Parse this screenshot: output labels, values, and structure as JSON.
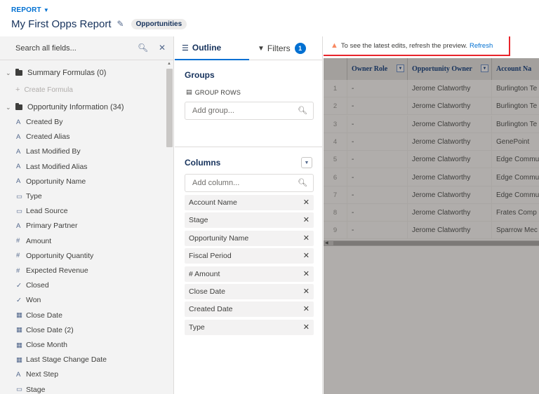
{
  "header": {
    "report_label": "REPORT",
    "title": "My First Opps Report",
    "type_pill": "Opportunities"
  },
  "field_panel": {
    "search_placeholder": "Search all fields...",
    "summary_folder": "Summary Formulas (0)",
    "create_formula": "Create Formula",
    "info_folder": "Opportunity Information (34)",
    "fields": [
      {
        "icon": "A",
        "label": "Created By"
      },
      {
        "icon": "A",
        "label": "Created Alias"
      },
      {
        "icon": "A",
        "label": "Last Modified By"
      },
      {
        "icon": "A",
        "label": "Last Modified Alias"
      },
      {
        "icon": "A",
        "label": "Opportunity Name"
      },
      {
        "icon": "▭",
        "label": "Type"
      },
      {
        "icon": "▭",
        "label": "Lead Source"
      },
      {
        "icon": "A",
        "label": "Primary Partner"
      },
      {
        "icon": "#",
        "label": "Amount"
      },
      {
        "icon": "#",
        "label": "Opportunity Quantity"
      },
      {
        "icon": "#",
        "label": "Expected Revenue"
      },
      {
        "icon": "✓",
        "label": "Closed"
      },
      {
        "icon": "✓",
        "label": "Won"
      },
      {
        "icon": "▦",
        "label": "Close Date"
      },
      {
        "icon": "▦",
        "label": "Close Date (2)"
      },
      {
        "icon": "▦",
        "label": "Close Month"
      },
      {
        "icon": "▦",
        "label": "Last Stage Change Date"
      },
      {
        "icon": "A",
        "label": "Next Step"
      },
      {
        "icon": "▭",
        "label": "Stage"
      }
    ]
  },
  "outline": {
    "tab_outline": "Outline",
    "tab_filters": "Filters",
    "filters_count": "1",
    "groups_title": "Groups",
    "group_rows_label": "GROUP ROWS",
    "add_group_placeholder": "Add group...",
    "columns_title": "Columns",
    "add_column_placeholder": "Add column...",
    "columns": [
      {
        "label": "Account Name"
      },
      {
        "label": "Stage"
      },
      {
        "label": "Opportunity Name"
      },
      {
        "label": "Fiscal Period"
      },
      {
        "label": "# Amount"
      },
      {
        "label": "Close Date"
      },
      {
        "label": "Created Date"
      },
      {
        "label": "Type"
      }
    ]
  },
  "preview": {
    "warning_text": "To see the latest edits, refresh the preview.",
    "refresh_link": "Refresh",
    "headers": [
      "Owner Role",
      "Opportunity Owner",
      "Account Na"
    ],
    "rows": [
      {
        "n": "1",
        "role": "-",
        "owner": "Jerome Clatworthy",
        "account": "Burlington Te"
      },
      {
        "n": "2",
        "role": "-",
        "owner": "Jerome Clatworthy",
        "account": "Burlington Te"
      },
      {
        "n": "3",
        "role": "-",
        "owner": "Jerome Clatworthy",
        "account": "Burlington Te"
      },
      {
        "n": "4",
        "role": "-",
        "owner": "Jerome Clatworthy",
        "account": "GenePoint"
      },
      {
        "n": "5",
        "role": "-",
        "owner": "Jerome Clatworthy",
        "account": "Edge Commu"
      },
      {
        "n": "6",
        "role": "-",
        "owner": "Jerome Clatworthy",
        "account": "Edge Commu"
      },
      {
        "n": "7",
        "role": "-",
        "owner": "Jerome Clatworthy",
        "account": "Edge Commu"
      },
      {
        "n": "8",
        "role": "-",
        "owner": "Jerome Clatworthy",
        "account": "Frates Comp"
      },
      {
        "n": "9",
        "role": "-",
        "owner": "Jerome Clatworthy",
        "account": "Sparrow Mec"
      }
    ]
  },
  "colors": {
    "accent": "#0070d2",
    "warning_border": "#e8242b",
    "preview_overlay": "#b0adab"
  }
}
